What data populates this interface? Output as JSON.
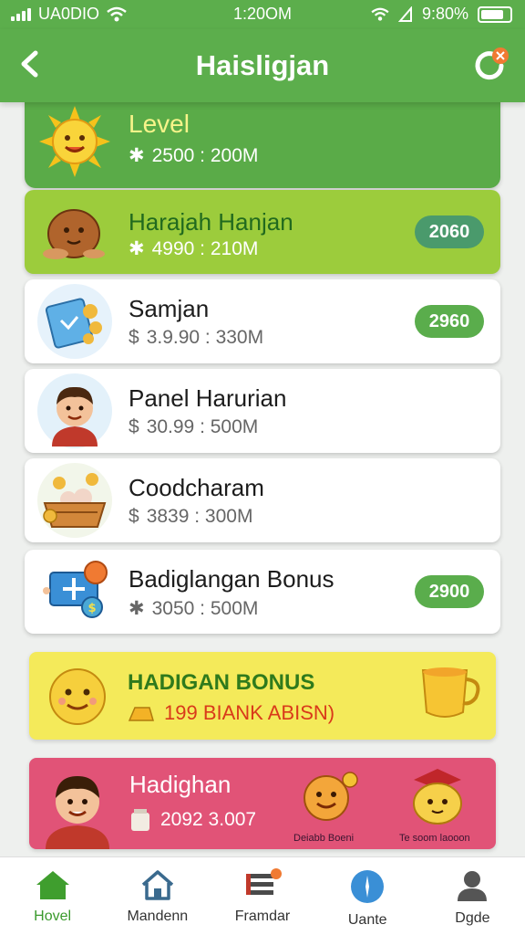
{
  "status_bar": {
    "carrier": "UA0DIO",
    "time": "1:20OM",
    "battery": "9:80%"
  },
  "header": {
    "title": "Haisligjan",
    "back_icon": "back-chevron-icon",
    "refresh_icon": "refresh-icon"
  },
  "colors": {
    "primary": "#5cae4c",
    "lime": "#9ccc3c",
    "pill_green": "#5aad4c",
    "bonus_yellow": "#f4ea5a",
    "promo_pink": "#e15377"
  },
  "level_card": {
    "title": "Level",
    "value": "2500 : 200M",
    "icon": "sun-character-icon"
  },
  "items": [
    {
      "name": "Harajah Hanjan",
      "value": "4990 : 210M",
      "badge": "2060",
      "icon": "potato-icon"
    },
    {
      "name": "Samjan",
      "value": "3.9.90 : 330M",
      "badge": "2960",
      "icon": "snack-bag-icon"
    },
    {
      "name": "Panel Harurian",
      "value": "30.99 : 500M",
      "badge": "",
      "icon": "boy-avatar-icon"
    },
    {
      "name": "Coodcharam",
      "value": "3839 : 300M",
      "badge": "",
      "icon": "food-basket-icon"
    },
    {
      "name": "Badiglangan Bonus",
      "value": "3050 : 500M",
      "badge": "2900",
      "icon": "money-icon"
    }
  ],
  "bonus_card": {
    "title": "HADIGAN BONUS",
    "subtitle": "199 BIANK ABISN)",
    "icon": "happy-face-icon",
    "right_icon": "golden-cup-icon"
  },
  "promo_card": {
    "title": "Hadighan",
    "subtitle": "2092 3.007",
    "caption_left": "Deiabb Boeni",
    "caption_right": "Te soom laooon"
  },
  "tabs": [
    {
      "label": "Hovel",
      "icon": "home-icon",
      "active": true
    },
    {
      "label": "Mandenn",
      "icon": "house-outline-icon",
      "active": false
    },
    {
      "label": "Framdar",
      "icon": "list-icon",
      "active": false
    },
    {
      "label": "Uante",
      "icon": "compass-icon",
      "active": false
    },
    {
      "label": "Dgde",
      "icon": "user-icon",
      "active": false
    }
  ]
}
